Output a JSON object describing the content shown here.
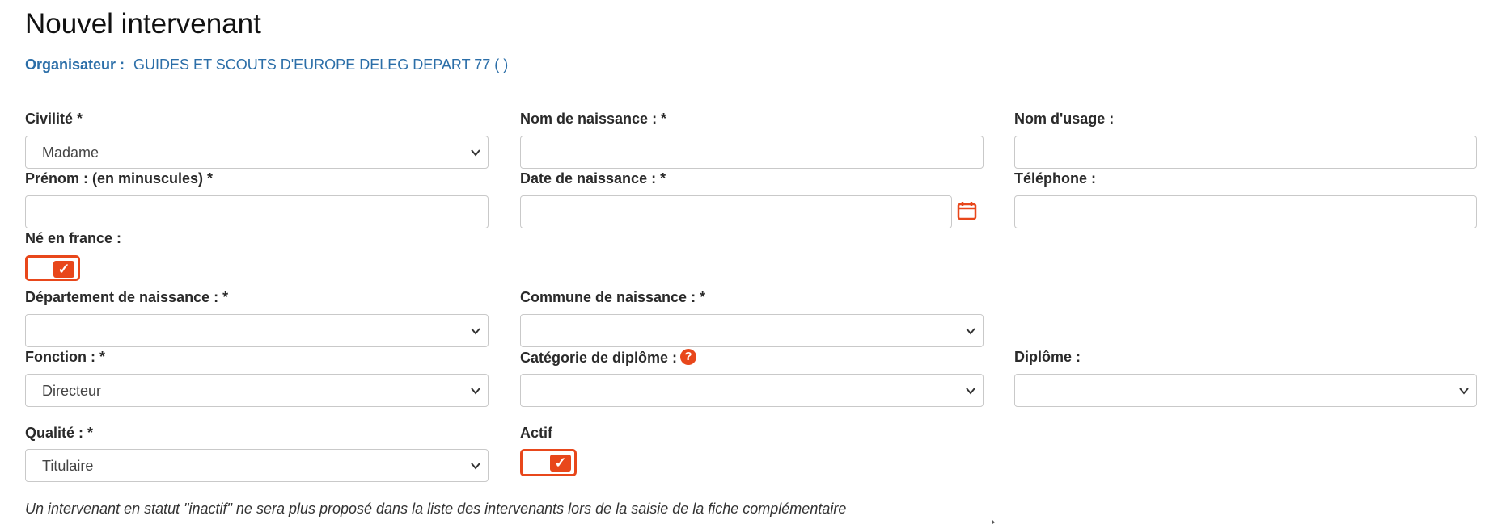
{
  "page": {
    "title": "Nouvel intervenant"
  },
  "organisateur": {
    "label": "Organisateur :",
    "value": "GUIDES ET SCOUTS D'EUROPE DELEG DEPART 77 ( )"
  },
  "form": {
    "civilite": {
      "label": "Civilité *",
      "value": "Madame"
    },
    "nom_naissance": {
      "label": "Nom de naissance : *",
      "value": ""
    },
    "nom_usage": {
      "label": "Nom d'usage :",
      "value": ""
    },
    "prenom": {
      "label": "Prénom : (en minuscules) *",
      "value": ""
    },
    "date_naissance": {
      "label": "Date de naissance : *",
      "value": ""
    },
    "telephone": {
      "label": "Téléphone :",
      "value": ""
    },
    "ne_en_france": {
      "label": "Né en france :",
      "checked": true
    },
    "departement": {
      "label": "Département de naissance : *",
      "value": ""
    },
    "commune": {
      "label": "Commune de naissance : *",
      "value": ""
    },
    "fonction": {
      "label": "Fonction : *",
      "value": "Directeur"
    },
    "categorie_diplome": {
      "label": "Catégorie de diplôme : *",
      "value": ""
    },
    "diplome": {
      "label": "Diplôme :",
      "value": ""
    },
    "qualite": {
      "label": "Qualité : *",
      "value": "Titulaire"
    },
    "actif": {
      "label": "Actif",
      "checked": true
    }
  },
  "note": "Un intervenant en statut \"inactif\" ne sera plus proposé dans la liste des intervenants lors de la saisie de la fiche complémentaire",
  "icons": {
    "check": "✓",
    "help": "?",
    "calendar": "calendar-icon",
    "chevron": "chevron-down-icon"
  },
  "colors": {
    "accent": "#e8471b",
    "link": "#2b6ea8",
    "border": "#c9c9c9"
  }
}
